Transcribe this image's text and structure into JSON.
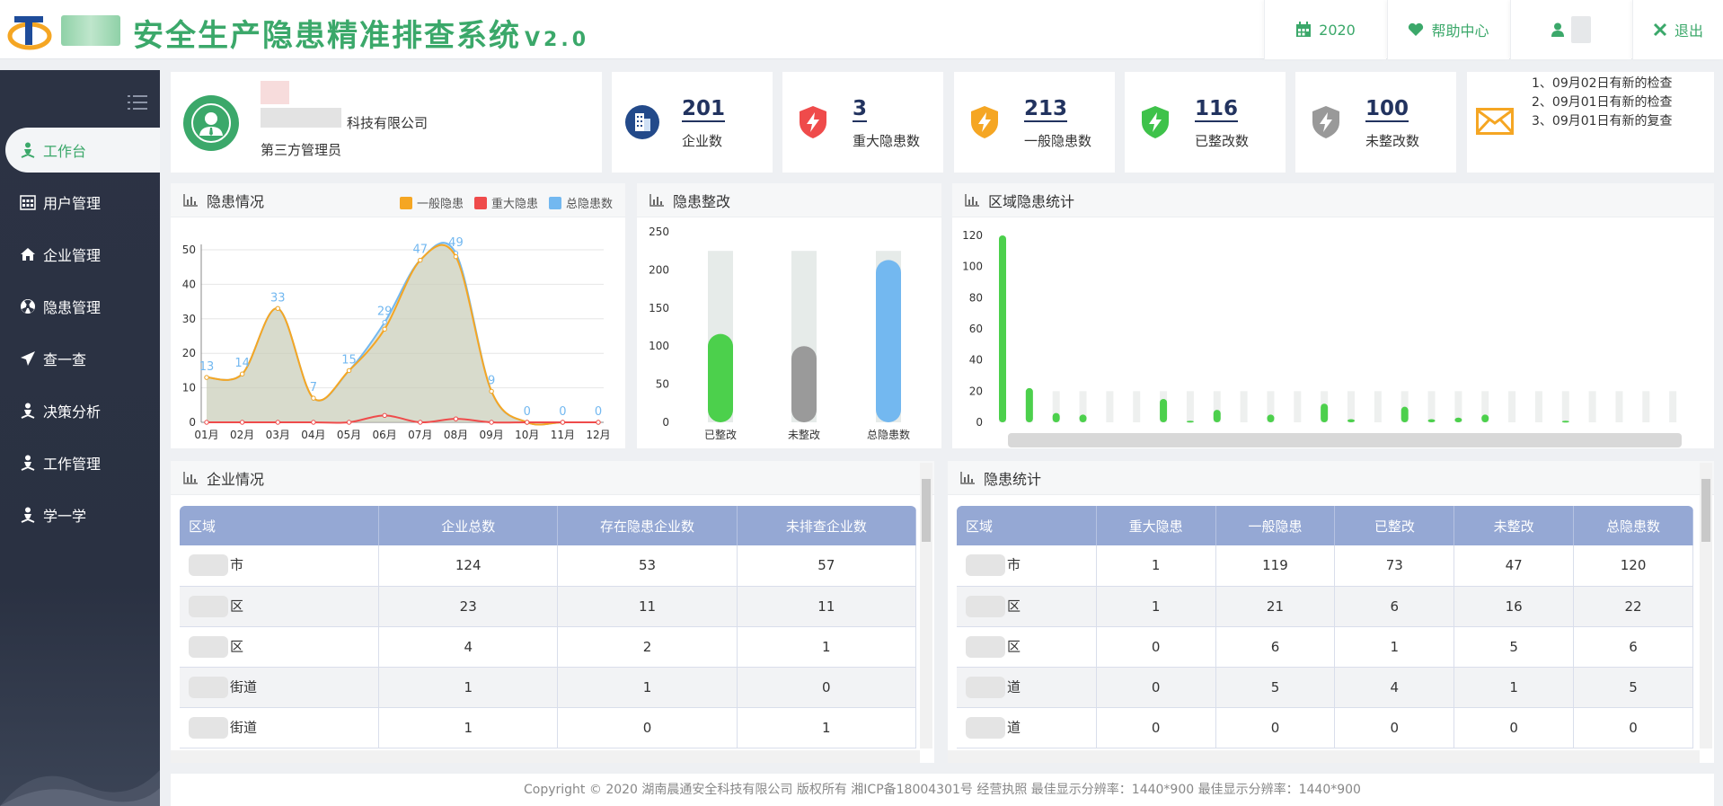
{
  "header": {
    "title": "安全生产隐患精准排查系统",
    "version": "V2.0",
    "year": "2020",
    "help": "帮助中心",
    "logout": "退出"
  },
  "sidebar": {
    "items": [
      {
        "label": "工作台",
        "icon": "person-icon",
        "active": true
      },
      {
        "label": "用户管理",
        "icon": "calendar-grid-icon"
      },
      {
        "label": "企业管理",
        "icon": "home-icon"
      },
      {
        "label": "隐患管理",
        "icon": "radiation-icon"
      },
      {
        "label": "查一查",
        "icon": "paper-plane-icon"
      },
      {
        "label": "决策分析",
        "icon": "person-icon"
      },
      {
        "label": "工作管理",
        "icon": "person-icon"
      },
      {
        "label": "学一学",
        "icon": "person-icon"
      }
    ]
  },
  "user": {
    "company": "科技有限公司",
    "role": "第三方管理员"
  },
  "stats": [
    {
      "value": "201",
      "label": "企业数",
      "color": "#234a8a",
      "icon": "building-icon"
    },
    {
      "value": "3",
      "label": "重大隐患数",
      "color": "#ef4b4b",
      "icon": "shield-bolt-icon"
    },
    {
      "value": "213",
      "label": "一般隐患数",
      "color": "#f5a623",
      "icon": "shield-bolt-icon"
    },
    {
      "value": "116",
      "label": "已整改数",
      "color": "#3ec24a",
      "icon": "shield-bolt-icon"
    },
    {
      "value": "100",
      "label": "未整改数",
      "color": "#999999",
      "icon": "shield-bolt-icon"
    }
  ],
  "notices": [
    "1、09月02日有新的检查",
    "2、09月01日有新的检查",
    "3、09月01日有新的复查"
  ],
  "panels": {
    "hazard_situation": "隐患情况",
    "hazard_rectify": "隐患整改",
    "region_stats": "区域隐患统计",
    "enterprise": "企业情况",
    "hazard_table": "隐患统计"
  },
  "chart_data": [
    {
      "type": "line",
      "title": "隐患情况",
      "categories": [
        "01月",
        "02月",
        "03月",
        "04月",
        "05月",
        "06月",
        "07月",
        "08月",
        "09月",
        "10月",
        "11月",
        "12月"
      ],
      "series": [
        {
          "name": "一般隐患",
          "color": "#f5a623",
          "values": [
            13,
            14,
            33,
            7,
            15,
            27,
            47,
            48,
            9,
            0,
            0,
            0
          ]
        },
        {
          "name": "重大隐患",
          "color": "#ef4b4b",
          "values": [
            0,
            0,
            0,
            0,
            0,
            2,
            0,
            1,
            0,
            0,
            0,
            0
          ]
        },
        {
          "name": "总隐患数",
          "color": "#73b8f0",
          "values": [
            13,
            14,
            33,
            7,
            15,
            29,
            47,
            49,
            9,
            0,
            0,
            0
          ]
        }
      ],
      "ylim": [
        0,
        50
      ],
      "yticks": [
        0,
        10,
        20,
        30,
        40,
        50
      ],
      "data_labels": [
        13,
        14,
        33,
        7,
        15,
        29,
        47,
        49,
        9,
        0,
        0,
        0
      ]
    },
    {
      "type": "bar",
      "title": "隐患整改",
      "categories": [
        "已整改",
        "未整改",
        "总隐患数"
      ],
      "values": [
        116,
        100,
        213
      ],
      "colors": [
        "#4cd04c",
        "#9a9a9a",
        "#73b8f0"
      ],
      "ylim": [
        0,
        250
      ],
      "yticks": [
        0,
        50,
        100,
        150,
        200,
        250
      ]
    },
    {
      "type": "bar",
      "title": "区域隐患统计",
      "values": [
        120,
        22,
        6,
        5,
        0,
        0,
        15,
        1,
        8,
        0,
        5,
        0,
        12,
        2,
        0,
        10,
        2,
        3,
        5,
        0,
        0,
        1,
        0,
        0,
        0,
        0
      ],
      "color": "#4cd04c",
      "ylim": [
        0,
        120
      ],
      "yticks": [
        0,
        20,
        40,
        60,
        80,
        100,
        120
      ]
    }
  ],
  "enterprise_table": {
    "headers": [
      "区域",
      "企业总数",
      "存在隐患企业数",
      "未排查企业数"
    ],
    "rows": [
      [
        "市",
        "124",
        "53",
        "57"
      ],
      [
        "区",
        "23",
        "11",
        "11"
      ],
      [
        "区",
        "4",
        "2",
        "1"
      ],
      [
        "街道",
        "1",
        "1",
        "0"
      ],
      [
        "街道",
        "1",
        "0",
        "1"
      ]
    ]
  },
  "hazard_table": {
    "headers": [
      "区域",
      "重大隐患",
      "一般隐患",
      "已整改",
      "未整改",
      "总隐患数"
    ],
    "rows": [
      [
        "市",
        "1",
        "119",
        "73",
        "47",
        "120"
      ],
      [
        "区",
        "1",
        "21",
        "6",
        "16",
        "22"
      ],
      [
        "区",
        "0",
        "6",
        "1",
        "5",
        "6"
      ],
      [
        "道",
        "0",
        "5",
        "4",
        "1",
        "5"
      ],
      [
        "道",
        "0",
        "0",
        "0",
        "0",
        "0"
      ]
    ]
  },
  "footer": "Copyright © 2020 湖南晨通安全科技有限公司 版权所有 湘ICP备18004301号 经营执照   最佳显示分辨率：1440*900 最佳显示分辨率：1440*900"
}
